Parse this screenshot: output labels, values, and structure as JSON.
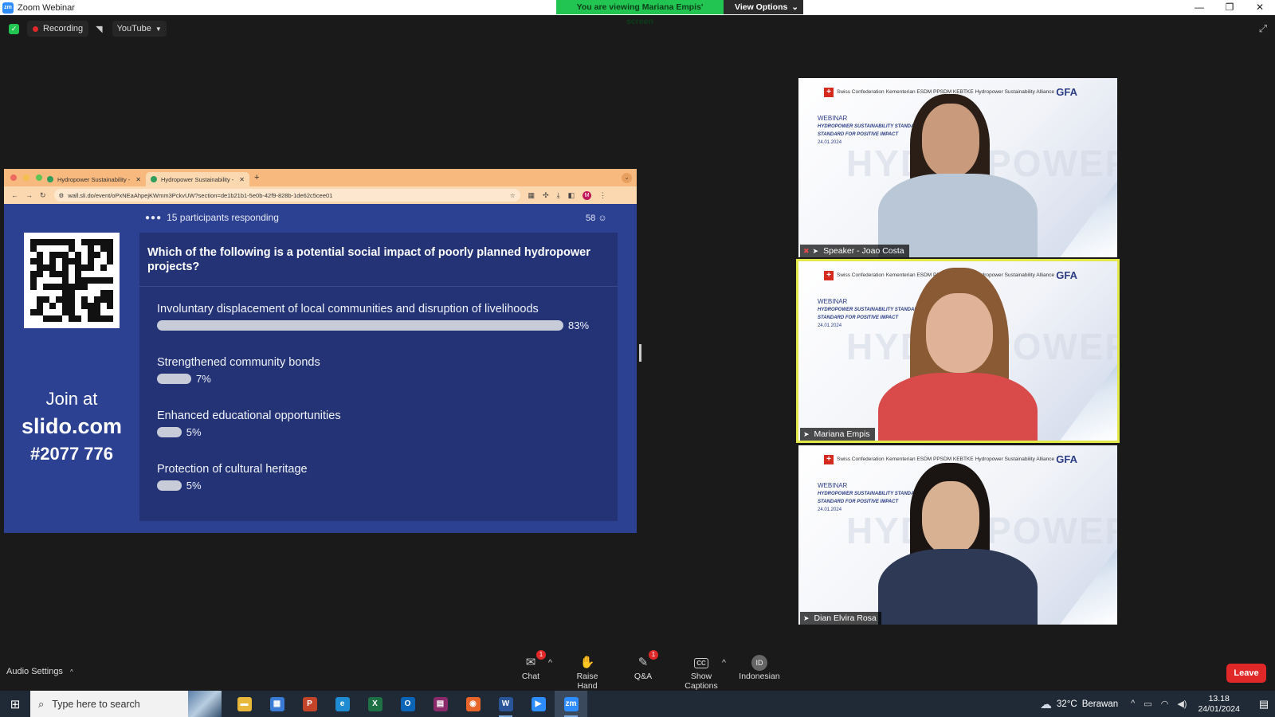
{
  "window": {
    "title": "Zoom Webinar",
    "viewing_banner": "You are viewing Mariana Empis' screen",
    "view_options": "View Options",
    "controls": [
      "—",
      "❐",
      "✕"
    ]
  },
  "meeting_top": {
    "recording_label": "Recording",
    "stream_label": "YouTube"
  },
  "browser": {
    "tabs": [
      {
        "label": "Hydropower Sustainability -",
        "active": false
      },
      {
        "label": "Hydropower Sustainability -",
        "active": true
      }
    ],
    "url": "wall.sli.do/event/oPxNEaAhpejKWmm3PckvUW?section=de1b21b1-5e0b-42f9-828b-1de62c5cee01",
    "profile_initial": "M"
  },
  "slido": {
    "participants_text": "15 participants responding",
    "count": "58",
    "join_line1": "Join at",
    "join_line2": "slido.com",
    "join_code": "#2077 776",
    "question": "Which of the following is a potential social impact of poorly planned hydropower projects?",
    "options": [
      {
        "label": "Involuntary displacement of local communities and disruption of livelihoods",
        "percent": 83,
        "percent_text": "83%"
      },
      {
        "label": "Strengthened community bonds",
        "percent": 7,
        "percent_text": "7%"
      },
      {
        "label": "Enhanced educational opportunities",
        "percent": 5,
        "percent_text": "5%"
      },
      {
        "label": "Protection of cultural heritage",
        "percent": 5,
        "percent_text": "5%"
      }
    ]
  },
  "tiles_common": {
    "logo1": "Swiss Confederation",
    "logo2": "Kementerian ESDM PPSDM KEBTKE",
    "logo3": "Hydropower Sustainability Alliance",
    "logo4": "GFA",
    "webinar": "WEBINAR",
    "webinar_title": "HYDROPOWER SUSTAINABILITY STANDARD: GLOBAL STANDARD FOR POSITIVE IMPACT",
    "date": "24.01.2024",
    "watermark": "HYDROPOWER"
  },
  "participants": [
    {
      "name": "Speaker - Joao Costa",
      "muted": true,
      "active": false,
      "shirt": "#b9c7d6",
      "hair": "#2a1e16",
      "skin": "#c99b7c"
    },
    {
      "name": "Mariana Empis",
      "muted": false,
      "active": true,
      "shirt": "#d94a4a",
      "hair": "#8a5a34",
      "skin": "#e0b298"
    },
    {
      "name": "Dian Elvira Rosa",
      "muted": false,
      "active": false,
      "shirt": "#2e3a55",
      "hair": "#1a1412",
      "skin": "#d8b092"
    }
  ],
  "bottom_controls": {
    "audio_settings": "Audio Settings",
    "chat": "Chat",
    "chat_badge": "1",
    "raise_hand": "Raise Hand",
    "qa": "Q&A",
    "qa_badge": "1",
    "show_captions": "Show Captions",
    "language_code": "ID",
    "language": "Indonesian",
    "leave": "Leave"
  },
  "taskbar": {
    "search_placeholder": "Type here to search",
    "apps": [
      {
        "name": "file-explorer",
        "glyph": "▬",
        "color": "#e8b83a",
        "running": false
      },
      {
        "name": "store",
        "glyph": "▦",
        "color": "#3a7bd5",
        "running": false
      },
      {
        "name": "powerpoint",
        "glyph": "P",
        "color": "#c4442a",
        "running": false
      },
      {
        "name": "edge",
        "glyph": "e",
        "color": "#1e8bd2",
        "running": false
      },
      {
        "name": "excel",
        "glyph": "X",
        "color": "#1e7145",
        "running": false
      },
      {
        "name": "outlook",
        "glyph": "O",
        "color": "#0a64b8",
        "running": false
      },
      {
        "name": "winrar",
        "glyph": "▤",
        "color": "#8a2a6a",
        "running": false
      },
      {
        "name": "firefox",
        "glyph": "◉",
        "color": "#e8652a",
        "running": false
      },
      {
        "name": "word",
        "glyph": "W",
        "color": "#2a5699",
        "running": true
      },
      {
        "name": "zoom",
        "glyph": "▶",
        "color": "#2d8cff",
        "running": false
      },
      {
        "name": "zoom-meeting",
        "glyph": "zm",
        "color": "#2d8cff",
        "running": true
      }
    ],
    "weather_temp": "32°C",
    "weather_desc": "Berawan",
    "time": "13.18",
    "date": "24/01/2024"
  }
}
